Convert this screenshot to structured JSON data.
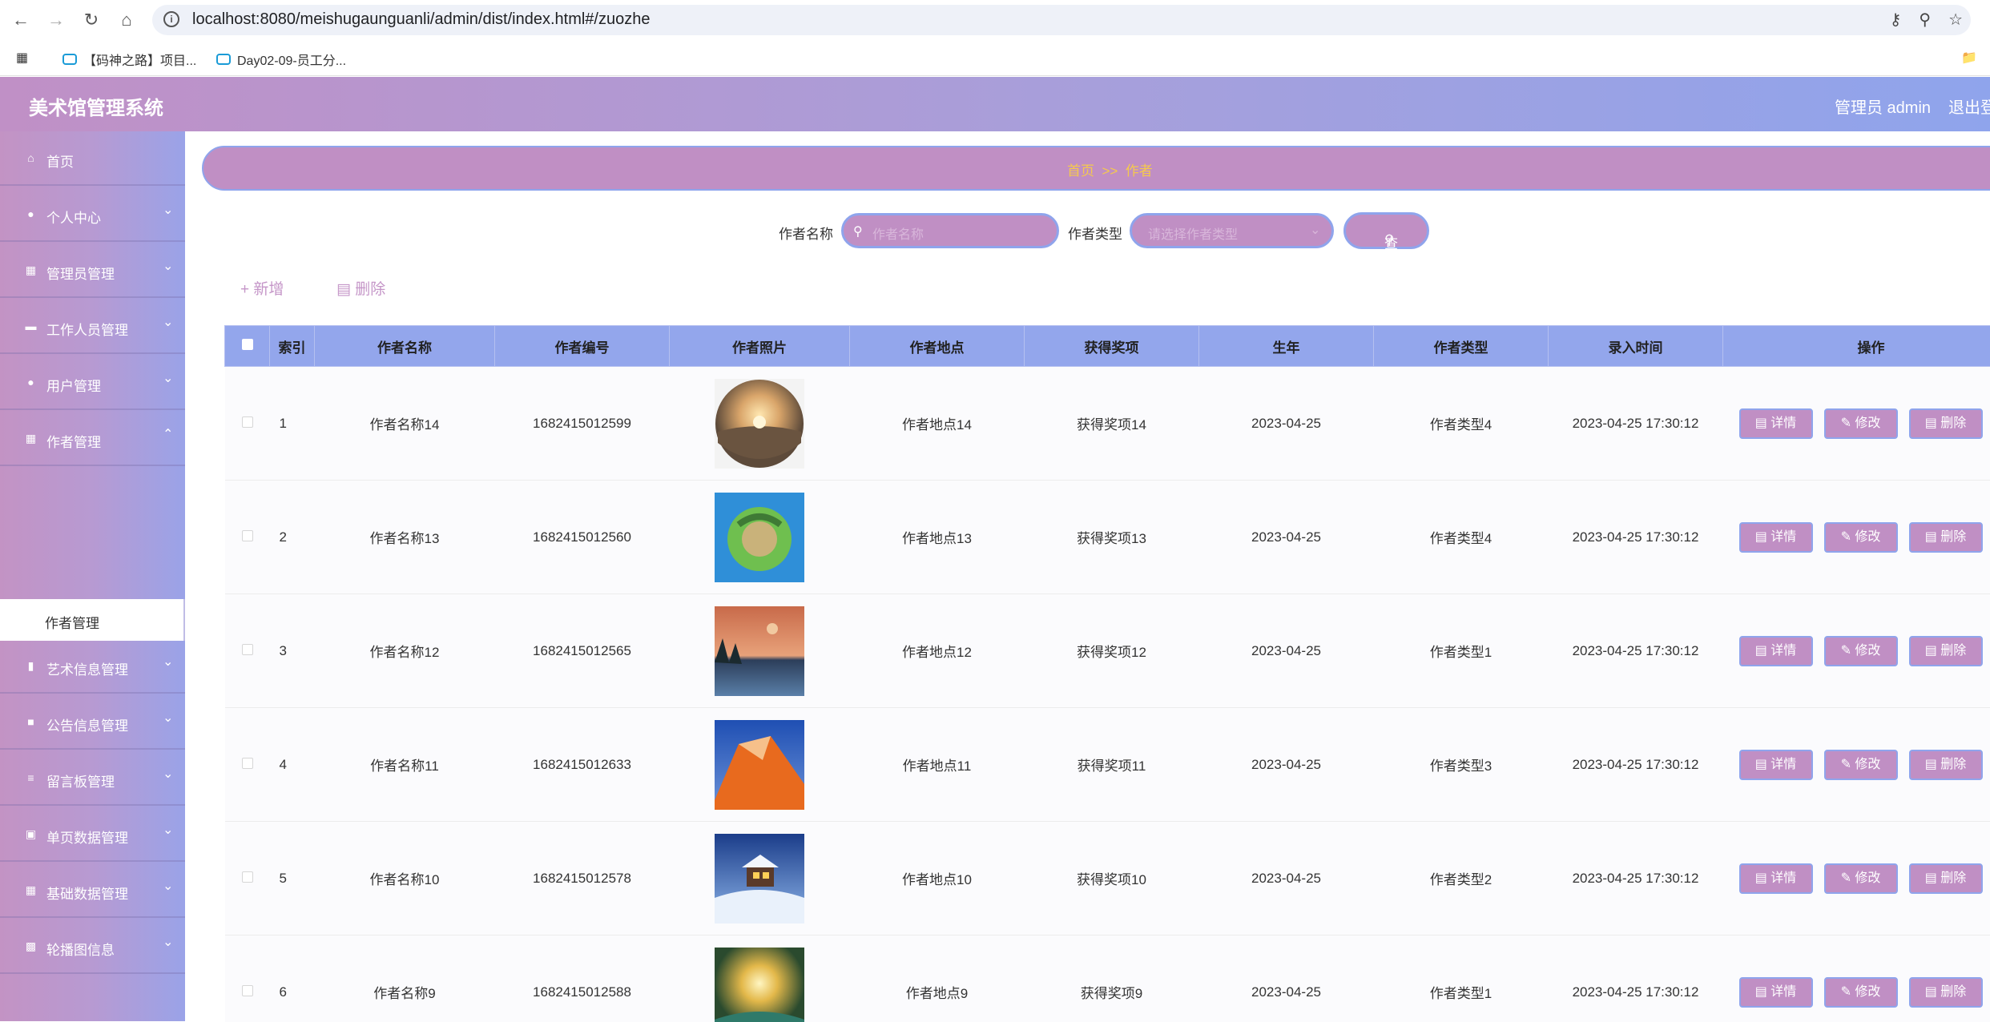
{
  "browser": {
    "url": "localhost:8080/meishugaunguanli/admin/dist/index.html#/zuozhe",
    "bookmarks": [
      "【码神之路】项目...",
      "Day02-09-员工分..."
    ]
  },
  "header": {
    "title": "美术馆管理系统",
    "user": "管理员 admin",
    "logout": "退出登录"
  },
  "sidebar": {
    "items": [
      {
        "label": "首页",
        "icon": "home-icon"
      },
      {
        "label": "个人中心",
        "icon": "user-icon"
      },
      {
        "label": "管理员管理",
        "icon": "grid-icon"
      },
      {
        "label": "工作人员管理",
        "icon": "card-icon"
      },
      {
        "label": "用户管理",
        "icon": "user-icon"
      },
      {
        "label": "作者管理",
        "icon": "grid-icon"
      },
      {
        "label": "艺术信息管理",
        "icon": "chart-icon"
      },
      {
        "label": "公告信息管理",
        "icon": "message-icon"
      },
      {
        "label": "留言板管理",
        "icon": "list-icon"
      },
      {
        "label": "单页数据管理",
        "icon": "monitor-icon"
      },
      {
        "label": "基础数据管理",
        "icon": "grid-icon"
      },
      {
        "label": "轮播图信息",
        "icon": "image-icon"
      }
    ],
    "active_sub": "作者管理"
  },
  "breadcrumb": {
    "home": "首页",
    "sep": ">>",
    "current": "作者"
  },
  "search": {
    "name_label": "作者名称",
    "name_placeholder": "作者名称",
    "type_label": "作者类型",
    "type_placeholder": "请选择作者类型",
    "button": "查询"
  },
  "actions": {
    "add": "新增",
    "delete": "删除"
  },
  "table": {
    "columns": [
      "索引",
      "作者名称",
      "作者编号",
      "作者照片",
      "作者地点",
      "获得奖项",
      "生年",
      "作者类型",
      "录入时间",
      "操作"
    ],
    "op_labels": {
      "detail": "详情",
      "edit": "修改",
      "delete": "删除"
    },
    "rows": [
      {
        "index": "1",
        "name": "作者名称14",
        "code": "1682415012599",
        "photo": "sunset-globe",
        "place": "作者地点14",
        "award": "获得奖项14",
        "year": "2023-04-25",
        "type": "作者类型4",
        "time": "2023-04-25 17:30:12"
      },
      {
        "index": "2",
        "name": "作者名称13",
        "code": "1682415012560",
        "photo": "tiny-planet",
        "place": "作者地点13",
        "award": "获得奖项13",
        "year": "2023-04-25",
        "type": "作者类型4",
        "time": "2023-04-25 17:30:12"
      },
      {
        "index": "3",
        "name": "作者名称12",
        "code": "1682415012565",
        "photo": "lake-sunset",
        "place": "作者地点12",
        "award": "获得奖项12",
        "year": "2023-04-25",
        "type": "作者类型1",
        "time": "2023-04-25 17:30:12"
      },
      {
        "index": "4",
        "name": "作者名称11",
        "code": "1682415012633",
        "photo": "orange-rock",
        "place": "作者地点11",
        "award": "获得奖项11",
        "year": "2023-04-25",
        "type": "作者类型3",
        "time": "2023-04-25 17:30:12"
      },
      {
        "index": "5",
        "name": "作者名称10",
        "code": "1682415012578",
        "photo": "snow-cabin",
        "place": "作者地点10",
        "award": "获得奖项10",
        "year": "2023-04-25",
        "type": "作者类型2",
        "time": "2023-04-25 17:30:12"
      },
      {
        "index": "6",
        "name": "作者名称9",
        "code": "1682415012588",
        "photo": "sunrise-valley",
        "place": "作者地点9",
        "award": "获得奖项9",
        "year": "2023-04-25",
        "type": "作者类型1",
        "time": "2023-04-25 17:30:12"
      }
    ]
  }
}
